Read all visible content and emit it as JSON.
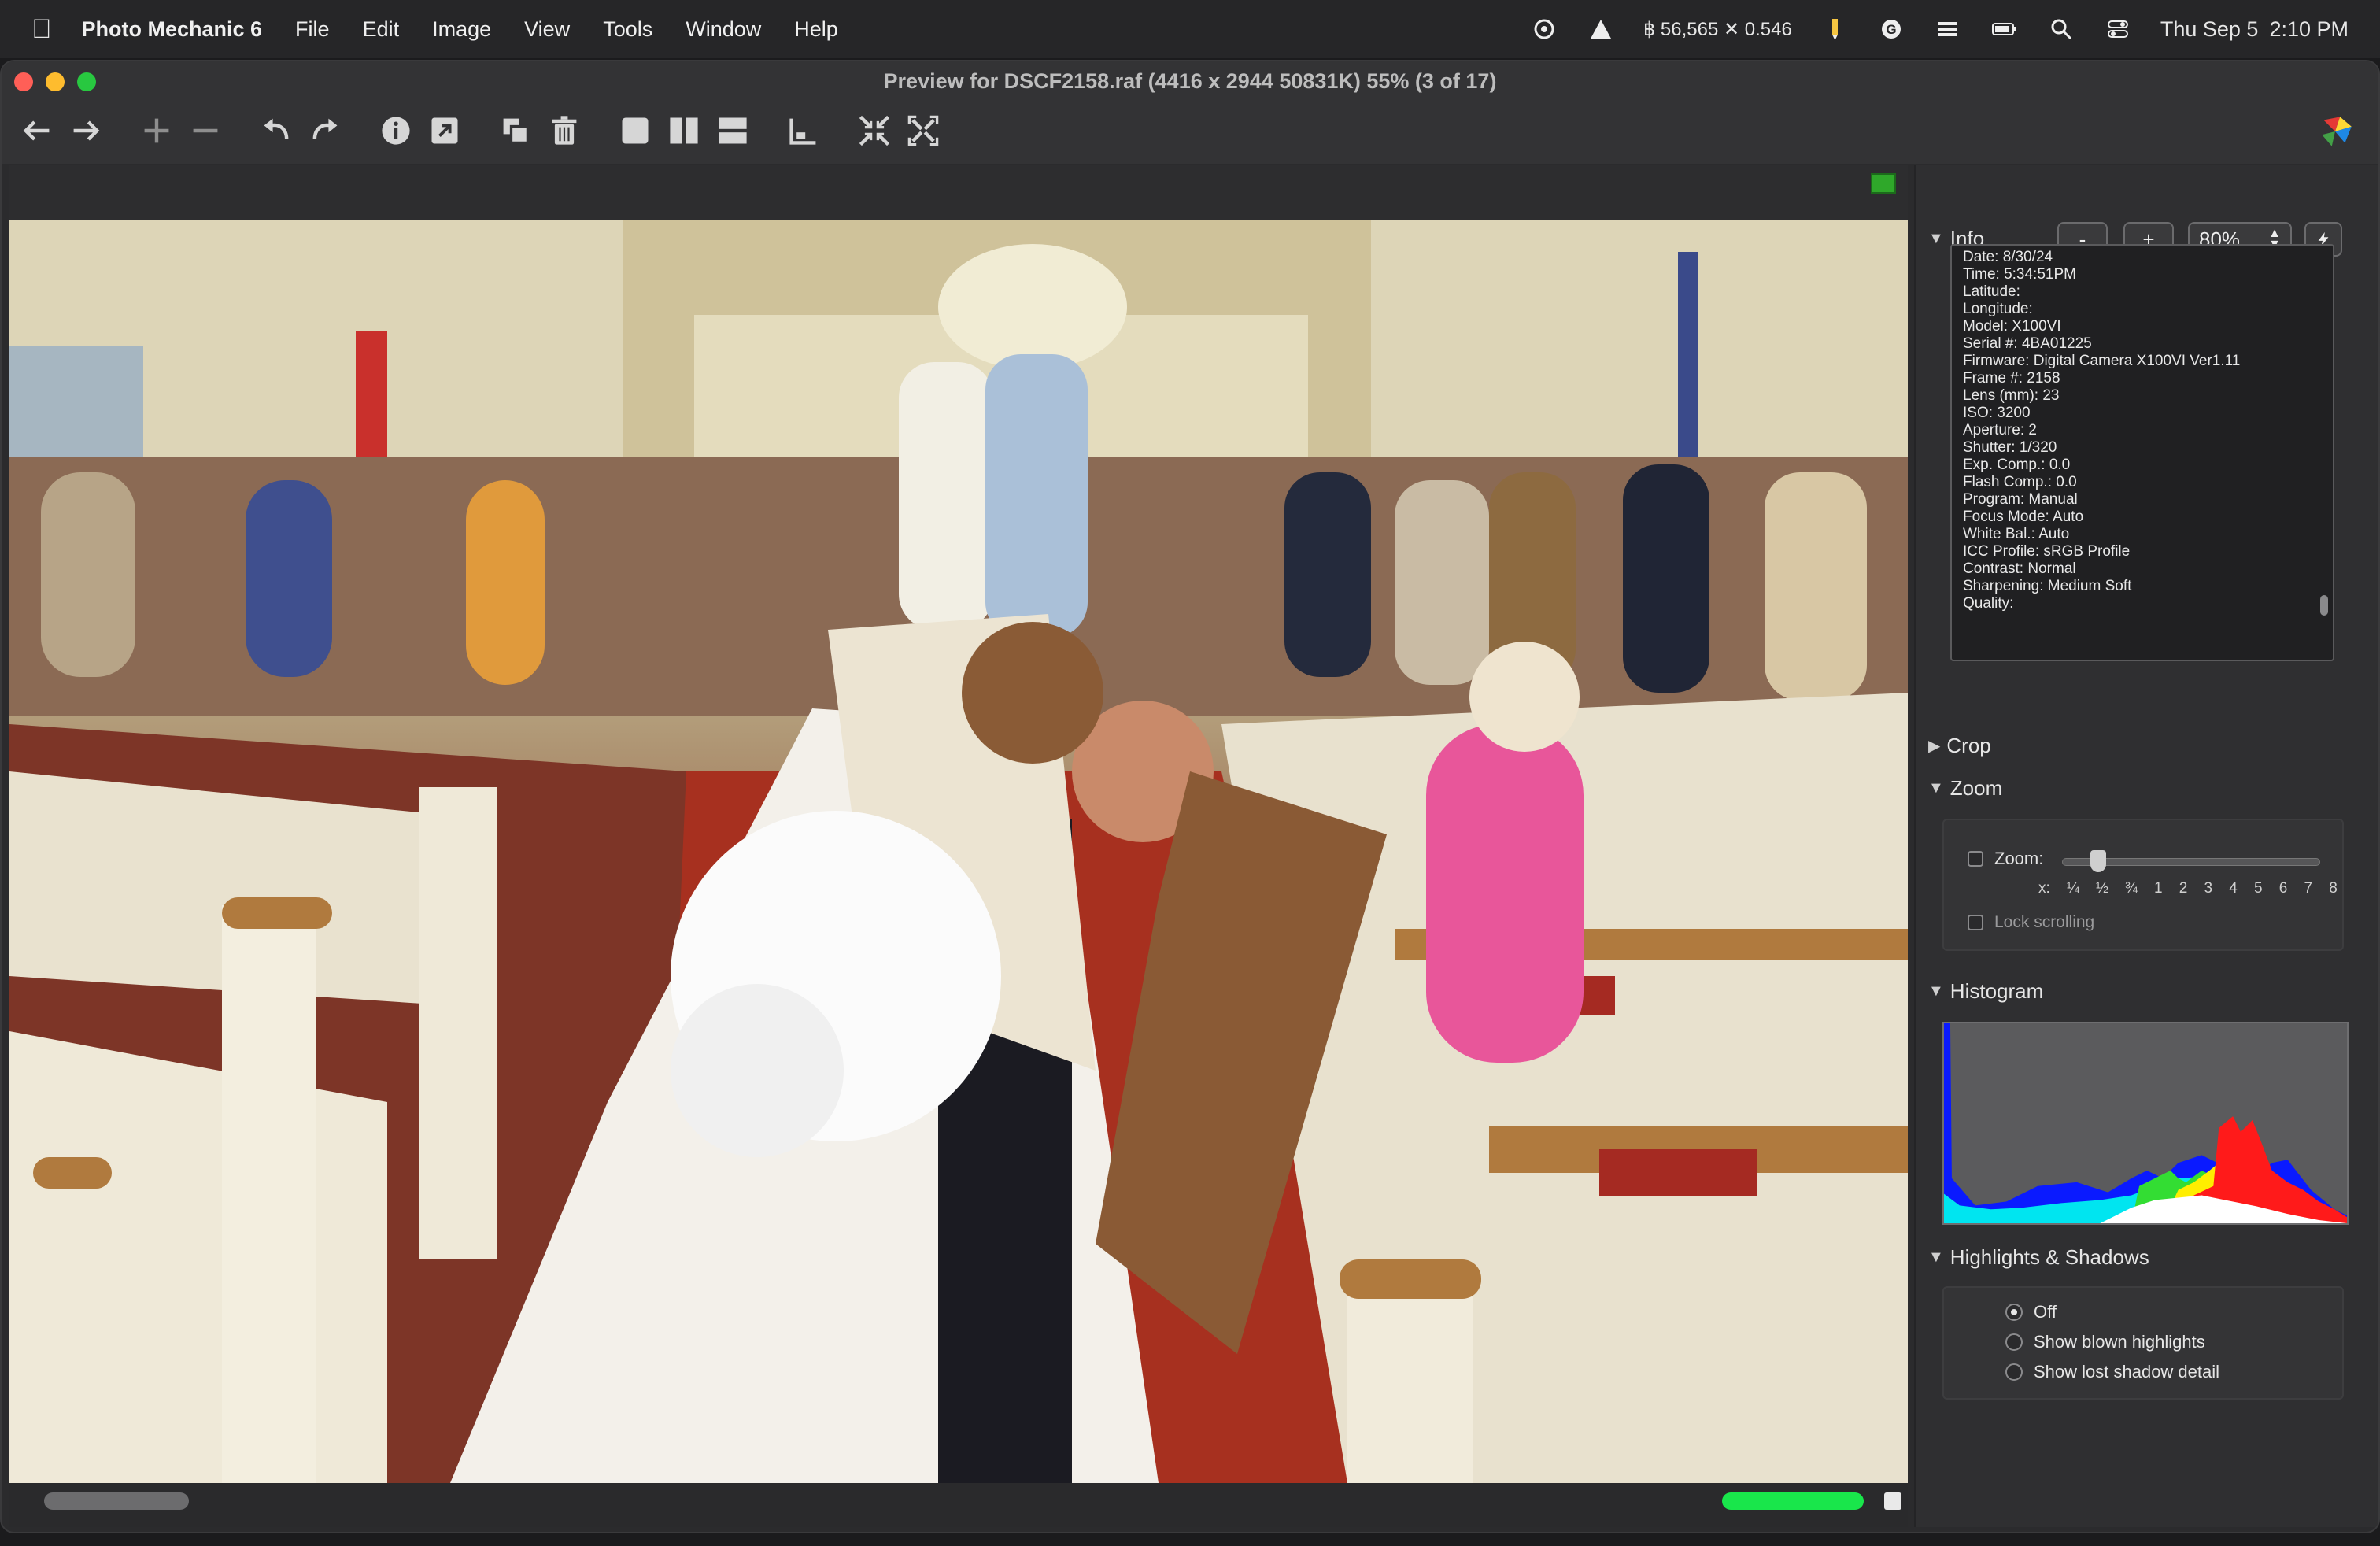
{
  "menubar": {
    "app": "Photo Mechanic 6",
    "items": [
      "File",
      "Edit",
      "Image",
      "View",
      "Tools",
      "Window",
      "Help"
    ],
    "btc": "฿ 56,565 ✕ 0.546",
    "date": "Thu Sep 5",
    "time": "2:10 PM"
  },
  "window": {
    "title": "Preview for DSCF2158.raf (4416 x 2944 50831K) 55% (3 of 17)"
  },
  "toolbar": {
    "icons": [
      "arrow-left-icon",
      "arrow-right-icon",
      "plus-icon",
      "minus-icon",
      "rotate-left-icon",
      "rotate-right-icon",
      "info-icon",
      "export-icon",
      "duplicate-icon",
      "trash-icon",
      "single-view-icon",
      "two-up-icon",
      "stacked-view-icon",
      "histogram-toggle-icon",
      "shrink-icon",
      "expand-icon"
    ]
  },
  "panel": {
    "info": {
      "label": "Info",
      "minus": "-",
      "plus": "+",
      "zoom_value": "80%",
      "lines": [
        "Date: 8/30/24",
        "Time: 5:34:51PM",
        "Latitude:",
        "Longitude:",
        "Model: X100VI",
        "Serial #: 4BA01225",
        "Firmware: Digital Camera X100VI Ver1.11",
        "Frame #: 2158",
        "Lens (mm): 23",
        "ISO: 3200",
        "Aperture: 2",
        "Shutter: 1/320",
        "Exp. Comp.: 0.0",
        "Flash Comp.: 0.0",
        "Program: Manual",
        "Focus Mode: Auto",
        "White Bal.: Auto",
        "ICC Profile: sRGB Profile",
        "Contrast: Normal",
        "Sharpening: Medium Soft",
        "Quality:"
      ]
    },
    "crop": {
      "label": "Crop"
    },
    "zoom": {
      "label": "Zoom",
      "checkbox_label": "Zoom:",
      "scale": [
        "x:",
        "¼",
        "½",
        "¾",
        "1",
        "2",
        "3",
        "4",
        "5",
        "6",
        "7",
        "8"
      ],
      "lock_label": "Lock scrolling"
    },
    "histogram": {
      "label": "Histogram"
    },
    "highlights": {
      "label": "Highlights & Shadows",
      "options": [
        "Off",
        "Show blown highlights",
        "Show lost shadow detail"
      ],
      "selected": "Off"
    }
  },
  "colors": {
    "color_tag": "#2fa82a",
    "progress": "#19e64b"
  }
}
